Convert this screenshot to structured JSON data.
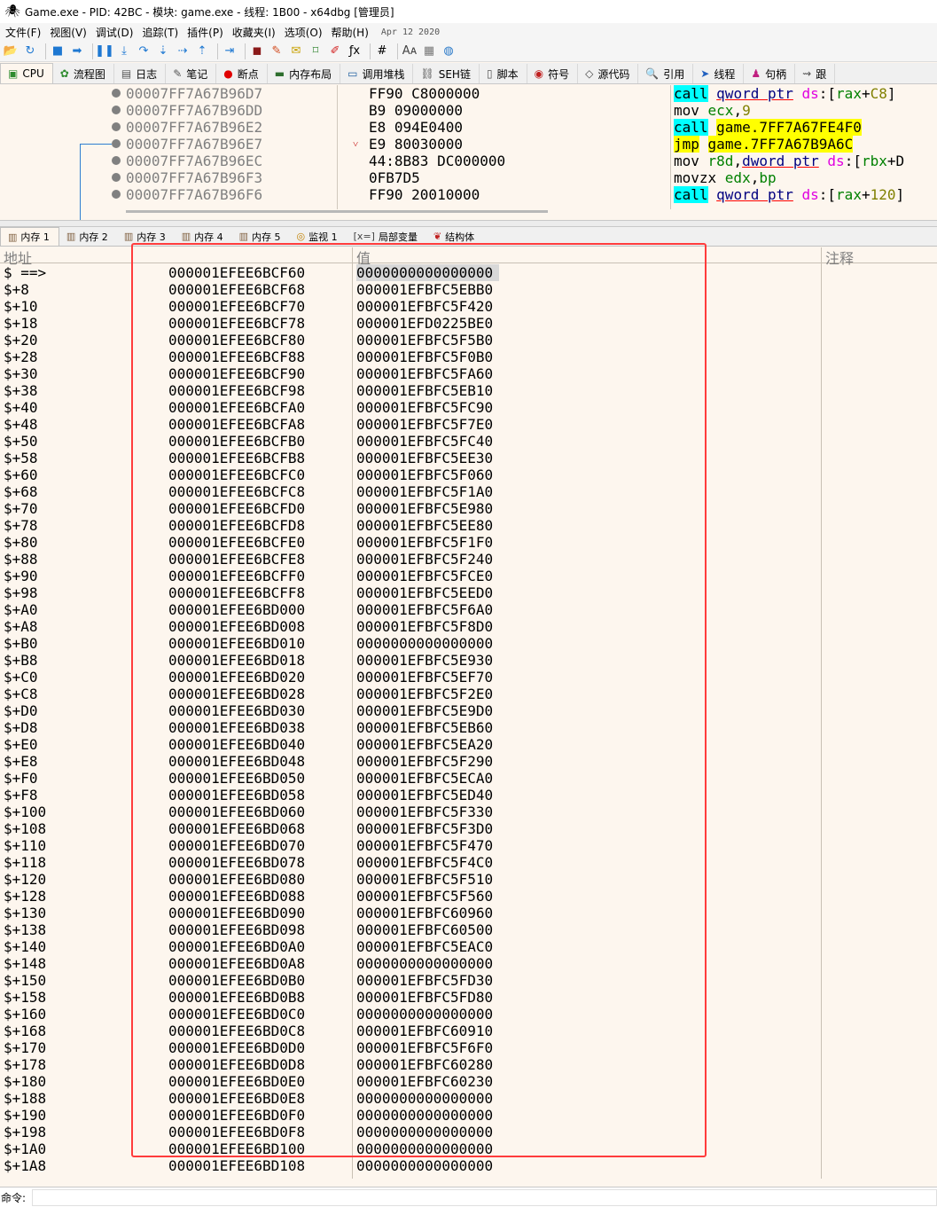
{
  "window": {
    "title": "Game.exe - PID: 42BC - 模块: game.exe - 线程: 1B00 - x64dbg [管理员]"
  },
  "menu": {
    "items": [
      "文件(F)",
      "视图(V)",
      "调试(D)",
      "追踪(T)",
      "插件(P)",
      "收藏夹(I)",
      "选项(O)",
      "帮助(H)"
    ],
    "date": "Apr 12 2020"
  },
  "toolbar": {
    "icons": [
      "open-icon",
      "restart-icon",
      "stop-icon",
      "run-icon",
      "pause-icon",
      "step-into-icon",
      "step-over-icon",
      "trace-into-icon",
      "trace-over-icon",
      "execute-till-return-icon",
      "run-to-user-code-icon",
      "scylla-icon",
      "patch-icon",
      "comment-icon",
      "label-icon",
      "bookmark-icon",
      "function-icon",
      "hash-icon",
      "font-size-icon",
      "calculator-icon",
      "globe-icon"
    ]
  },
  "main_tabs": [
    {
      "label": "CPU",
      "icon": "cpu-icon"
    },
    {
      "label": "流程图",
      "icon": "graph-icon"
    },
    {
      "label": "日志",
      "icon": "log-icon"
    },
    {
      "label": "笔记",
      "icon": "notes-icon"
    },
    {
      "label": "断点",
      "icon": "breakpoint-icon"
    },
    {
      "label": "内存布局",
      "icon": "memory-map-icon"
    },
    {
      "label": "调用堆栈",
      "icon": "call-stack-icon"
    },
    {
      "label": "SEH链",
      "icon": "seh-icon"
    },
    {
      "label": "脚本",
      "icon": "script-icon"
    },
    {
      "label": "符号",
      "icon": "symbols-icon"
    },
    {
      "label": "源代码",
      "icon": "source-icon"
    },
    {
      "label": "引用",
      "icon": "references-icon"
    },
    {
      "label": "线程",
      "icon": "threads-icon"
    },
    {
      "label": "句柄",
      "icon": "handles-icon"
    },
    {
      "label": "跟",
      "icon": "trace-icon"
    }
  ],
  "disasm": {
    "rows": [
      {
        "addr": "00007FF7A67B96D7",
        "bytes": "FF90 C8000000",
        "arrow": "",
        "parts": [
          [
            "call",
            "k-call"
          ],
          [
            " ",
            ""
          ],
          [
            "qword ptr",
            "k-ptr"
          ],
          [
            " ",
            ""
          ],
          [
            "ds",
            "k-seg"
          ],
          [
            ":[",
            ""
          ],
          [
            "rax",
            "k-reg"
          ],
          [
            "+",
            ""
          ],
          [
            "C8",
            "k-num"
          ],
          [
            "]",
            ""
          ]
        ]
      },
      {
        "addr": "00007FF7A67B96DD",
        "bytes": "B9 09000000",
        "arrow": "",
        "parts": [
          [
            "mov ",
            ""
          ],
          [
            "ecx",
            "k-reg"
          ],
          [
            ",",
            ""
          ],
          [
            "9",
            "k-num"
          ]
        ]
      },
      {
        "addr": "00007FF7A67B96E2",
        "bytes": "E8 094E0400",
        "arrow": "",
        "parts": [
          [
            "call",
            "k-call"
          ],
          [
            " ",
            ""
          ],
          [
            "game.7FF7A67FE4F0",
            "k-tgt"
          ]
        ]
      },
      {
        "addr": "00007FF7A67B96E7",
        "bytes": "E9 80030000",
        "arrow": "˅",
        "parts": [
          [
            "jmp",
            "k-jmp"
          ],
          [
            " ",
            ""
          ],
          [
            "game.7FF7A67B9A6C",
            "k-tgt"
          ]
        ]
      },
      {
        "addr": "00007FF7A67B96EC",
        "bytes": "44:8B83 DC000000",
        "arrow": "",
        "parts": [
          [
            "mov ",
            ""
          ],
          [
            "r8d",
            "k-reg"
          ],
          [
            ",",
            ""
          ],
          [
            "dword ptr",
            "k-ptr"
          ],
          [
            " ",
            ""
          ],
          [
            "ds",
            "k-seg"
          ],
          [
            ":[",
            ""
          ],
          [
            "rbx",
            "k-reg"
          ],
          [
            "+D",
            ""
          ]
        ]
      },
      {
        "addr": "00007FF7A67B96F3",
        "bytes": "0FB7D5",
        "arrow": "",
        "parts": [
          [
            "movzx ",
            ""
          ],
          [
            "edx",
            "k-reg"
          ],
          [
            ",",
            ""
          ],
          [
            "bp",
            "k-reg"
          ]
        ]
      },
      {
        "addr": "00007FF7A67B96F6",
        "bytes": "FF90 20010000",
        "arrow": "",
        "parts": [
          [
            "call",
            "k-call"
          ],
          [
            " ",
            ""
          ],
          [
            "qword ptr",
            "k-ptr"
          ],
          [
            " ",
            ""
          ],
          [
            "ds",
            "k-seg"
          ],
          [
            ":[",
            ""
          ],
          [
            "rax",
            "k-reg"
          ],
          [
            "+",
            ""
          ],
          [
            "120",
            "k-num"
          ],
          [
            "]",
            ""
          ]
        ]
      }
    ]
  },
  "mem_tabs": [
    {
      "label": "内存 1",
      "icon": "memory-icon"
    },
    {
      "label": "内存 2",
      "icon": "memory-icon"
    },
    {
      "label": "内存 3",
      "icon": "memory-icon"
    },
    {
      "label": "内存 4",
      "icon": "memory-icon"
    },
    {
      "label": "内存 5",
      "icon": "memory-icon"
    },
    {
      "label": "监视 1",
      "icon": "watch-icon"
    },
    {
      "label": "局部变量",
      "icon": "locals-icon"
    },
    {
      "label": "结构体",
      "icon": "struct-icon"
    }
  ],
  "dump": {
    "headers": {
      "address": "地址",
      "value": "值",
      "comment": "注释"
    },
    "rows": [
      [
        "$ ==>",
        "000001EFEE6BCF60",
        "0000000000000000"
      ],
      [
        "$+8",
        "000001EFEE6BCF68",
        "000001EFBFC5EBB0"
      ],
      [
        "$+10",
        "000001EFEE6BCF70",
        "000001EFBFC5F420"
      ],
      [
        "$+18",
        "000001EFEE6BCF78",
        "000001EFD0225BE0"
      ],
      [
        "$+20",
        "000001EFEE6BCF80",
        "000001EFBFC5F5B0"
      ],
      [
        "$+28",
        "000001EFEE6BCF88",
        "000001EFBFC5F0B0"
      ],
      [
        "$+30",
        "000001EFEE6BCF90",
        "000001EFBFC5FA60"
      ],
      [
        "$+38",
        "000001EFEE6BCF98",
        "000001EFBFC5EB10"
      ],
      [
        "$+40",
        "000001EFEE6BCFA0",
        "000001EFBFC5FC90"
      ],
      [
        "$+48",
        "000001EFEE6BCFA8",
        "000001EFBFC5F7E0"
      ],
      [
        "$+50",
        "000001EFEE6BCFB0",
        "000001EFBFC5FC40"
      ],
      [
        "$+58",
        "000001EFEE6BCFB8",
        "000001EFBFC5EE30"
      ],
      [
        "$+60",
        "000001EFEE6BCFC0",
        "000001EFBFC5F060"
      ],
      [
        "$+68",
        "000001EFEE6BCFC8",
        "000001EFBFC5F1A0"
      ],
      [
        "$+70",
        "000001EFEE6BCFD0",
        "000001EFBFC5E980"
      ],
      [
        "$+78",
        "000001EFEE6BCFD8",
        "000001EFBFC5EE80"
      ],
      [
        "$+80",
        "000001EFEE6BCFE0",
        "000001EFBFC5F1F0"
      ],
      [
        "$+88",
        "000001EFEE6BCFE8",
        "000001EFBFC5F240"
      ],
      [
        "$+90",
        "000001EFEE6BCFF0",
        "000001EFBFC5FCE0"
      ],
      [
        "$+98",
        "000001EFEE6BCFF8",
        "000001EFBFC5EED0"
      ],
      [
        "$+A0",
        "000001EFEE6BD000",
        "000001EFBFC5F6A0"
      ],
      [
        "$+A8",
        "000001EFEE6BD008",
        "000001EFBFC5F8D0"
      ],
      [
        "$+B0",
        "000001EFEE6BD010",
        "0000000000000000"
      ],
      [
        "$+B8",
        "000001EFEE6BD018",
        "000001EFBFC5E930"
      ],
      [
        "$+C0",
        "000001EFEE6BD020",
        "000001EFBFC5EF70"
      ],
      [
        "$+C8",
        "000001EFEE6BD028",
        "000001EFBFC5F2E0"
      ],
      [
        "$+D0",
        "000001EFEE6BD030",
        "000001EFBFC5E9D0"
      ],
      [
        "$+D8",
        "000001EFEE6BD038",
        "000001EFBFC5EB60"
      ],
      [
        "$+E0",
        "000001EFEE6BD040",
        "000001EFBFC5EA20"
      ],
      [
        "$+E8",
        "000001EFEE6BD048",
        "000001EFBFC5F290"
      ],
      [
        "$+F0",
        "000001EFEE6BD050",
        "000001EFBFC5ECA0"
      ],
      [
        "$+F8",
        "000001EFEE6BD058",
        "000001EFBFC5ED40"
      ],
      [
        "$+100",
        "000001EFEE6BD060",
        "000001EFBFC5F330"
      ],
      [
        "$+108",
        "000001EFEE6BD068",
        "000001EFBFC5F3D0"
      ],
      [
        "$+110",
        "000001EFEE6BD070",
        "000001EFBFC5F470"
      ],
      [
        "$+118",
        "000001EFEE6BD078",
        "000001EFBFC5F4C0"
      ],
      [
        "$+120",
        "000001EFEE6BD080",
        "000001EFBFC5F510"
      ],
      [
        "$+128",
        "000001EFEE6BD088",
        "000001EFBFC5F560"
      ],
      [
        "$+130",
        "000001EFEE6BD090",
        "000001EFBFC60960"
      ],
      [
        "$+138",
        "000001EFEE6BD098",
        "000001EFBFC60500"
      ],
      [
        "$+140",
        "000001EFEE6BD0A0",
        "000001EFBFC5EAC0"
      ],
      [
        "$+148",
        "000001EFEE6BD0A8",
        "0000000000000000"
      ],
      [
        "$+150",
        "000001EFEE6BD0B0",
        "000001EFBFC5FD30"
      ],
      [
        "$+158",
        "000001EFEE6BD0B8",
        "000001EFBFC5FD80"
      ],
      [
        "$+160",
        "000001EFEE6BD0C0",
        "0000000000000000"
      ],
      [
        "$+168",
        "000001EFEE6BD0C8",
        "000001EFBFC60910"
      ],
      [
        "$+170",
        "000001EFEE6BD0D0",
        "000001EFBFC5F6F0"
      ],
      [
        "$+178",
        "000001EFEE6BD0D8",
        "000001EFBFC60280"
      ],
      [
        "$+180",
        "000001EFEE6BD0E0",
        "000001EFBFC60230"
      ],
      [
        "$+188",
        "000001EFEE6BD0E8",
        "0000000000000000"
      ],
      [
        "$+190",
        "000001EFEE6BD0F0",
        "0000000000000000"
      ],
      [
        "$+198",
        "000001EFEE6BD0F8",
        "0000000000000000"
      ],
      [
        "$+1A0",
        "000001EFEE6BD100",
        "0000000000000000"
      ],
      [
        "$+1A8",
        "000001EFEE6BD108",
        "0000000000000000"
      ]
    ]
  },
  "command": {
    "label": "命令:",
    "value": ""
  },
  "colors": {
    "call_bg": "#00ffff",
    "jmp_bg": "#ffff00",
    "highlight_box": "#ff3c3c",
    "pane_bg": "#fdf6ee"
  }
}
